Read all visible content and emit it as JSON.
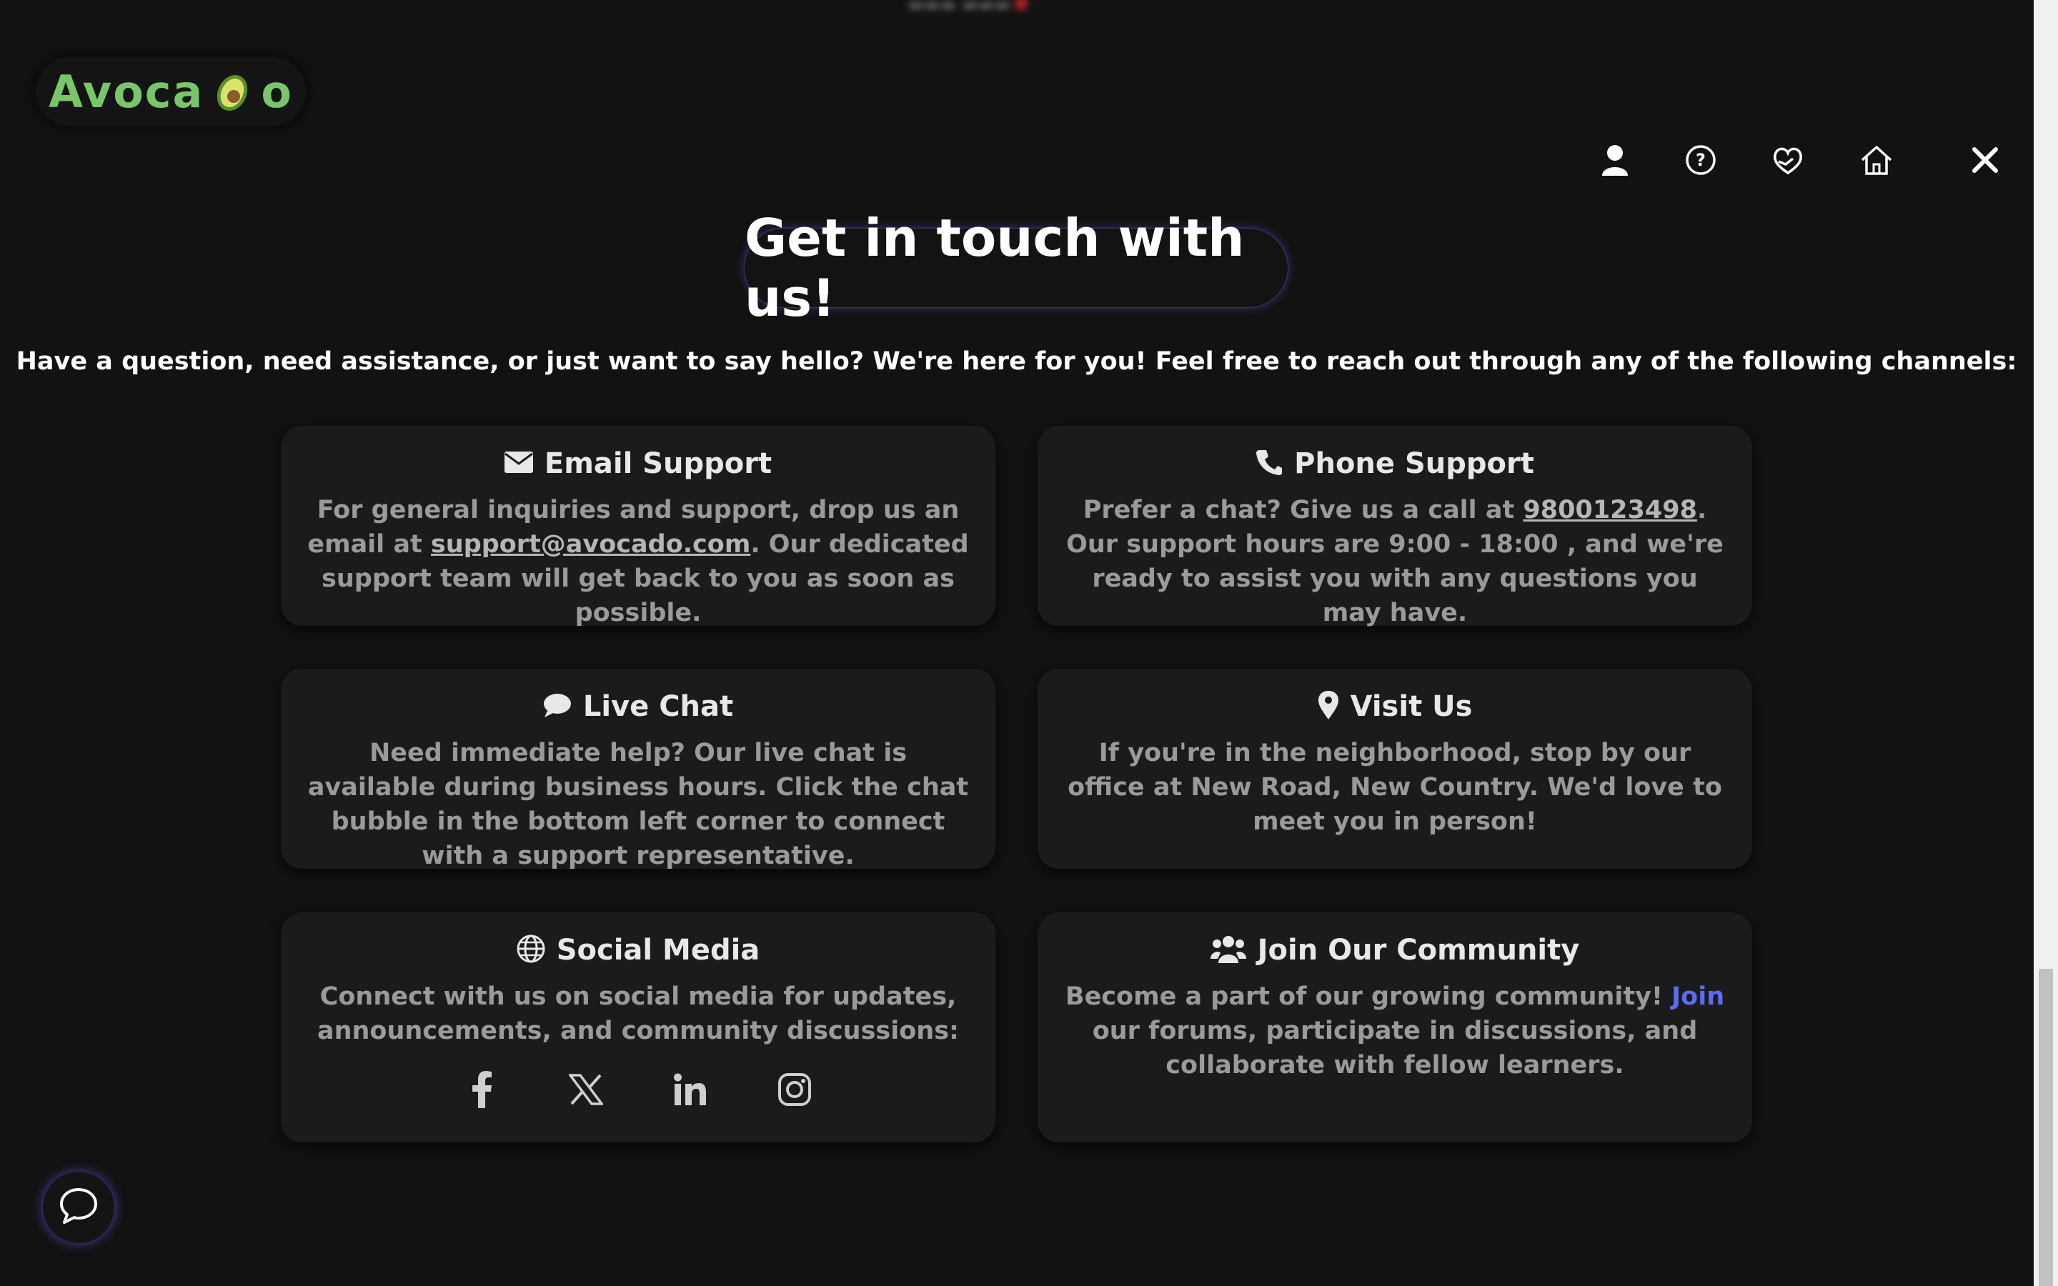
{
  "brand": {
    "logo_text_start": "Avoca",
    "logo_text_end": "o",
    "logo_icon": "avocado-icon"
  },
  "nav": {
    "icons": [
      "user-icon",
      "help-circle-icon",
      "donate-heart-icon",
      "home-icon"
    ],
    "close_icon": "close-icon"
  },
  "header": {
    "title": "Get in touch with us!",
    "subtitle": "Have a question, need assistance, or just want to say hello? We're here for you! Feel free to reach out through any of the following channels:"
  },
  "cards": {
    "email": {
      "title": "Email Support",
      "icon": "envelope-icon",
      "text_before": "For general inquiries and support, drop us an email at ",
      "link": "support@avocado.com",
      "text_after": ". Our dedicated support team will get back to you as soon as possible."
    },
    "phone": {
      "title": "Phone Support",
      "icon": "phone-icon",
      "text_before": "Prefer a chat? Give us a call at ",
      "link": "9800123498",
      "text_after": ". Our support hours are 9:00 - 18:00 , and we're ready to assist you with any questions you may have."
    },
    "chat": {
      "title": "Live Chat",
      "icon": "chat-bubble-icon",
      "text": "Need immediate help? Our live chat is available during business hours. Click the chat bubble in the bottom left corner to connect with a support representative."
    },
    "visit": {
      "title": "Visit Us",
      "icon": "map-pin-icon",
      "text": "If you're in the neighborhood, stop by our office at New Road, New Country. We'd love to meet you in person!"
    },
    "social": {
      "title": "Social Media",
      "icon": "globe-icon",
      "text": "Connect with us on social media for updates, announcements, and community discussions:",
      "links": [
        "facebook-icon",
        "x-twitter-icon",
        "linkedin-icon",
        "instagram-icon"
      ]
    },
    "community": {
      "title": "Join Our Community",
      "icon": "users-icon",
      "text_before": "Become a part of our growing community! ",
      "link": "Join",
      "text_after": " our forums, participate in discussions, and collaborate with fellow learners."
    }
  },
  "colors": {
    "background": "#121212",
    "card": "#1b1b1b",
    "accent_green": "#79c66a",
    "join_link": "#5a6cf0",
    "glow": "#6e5aff"
  },
  "chat_widget": {
    "icon": "chat-bubble-icon"
  }
}
